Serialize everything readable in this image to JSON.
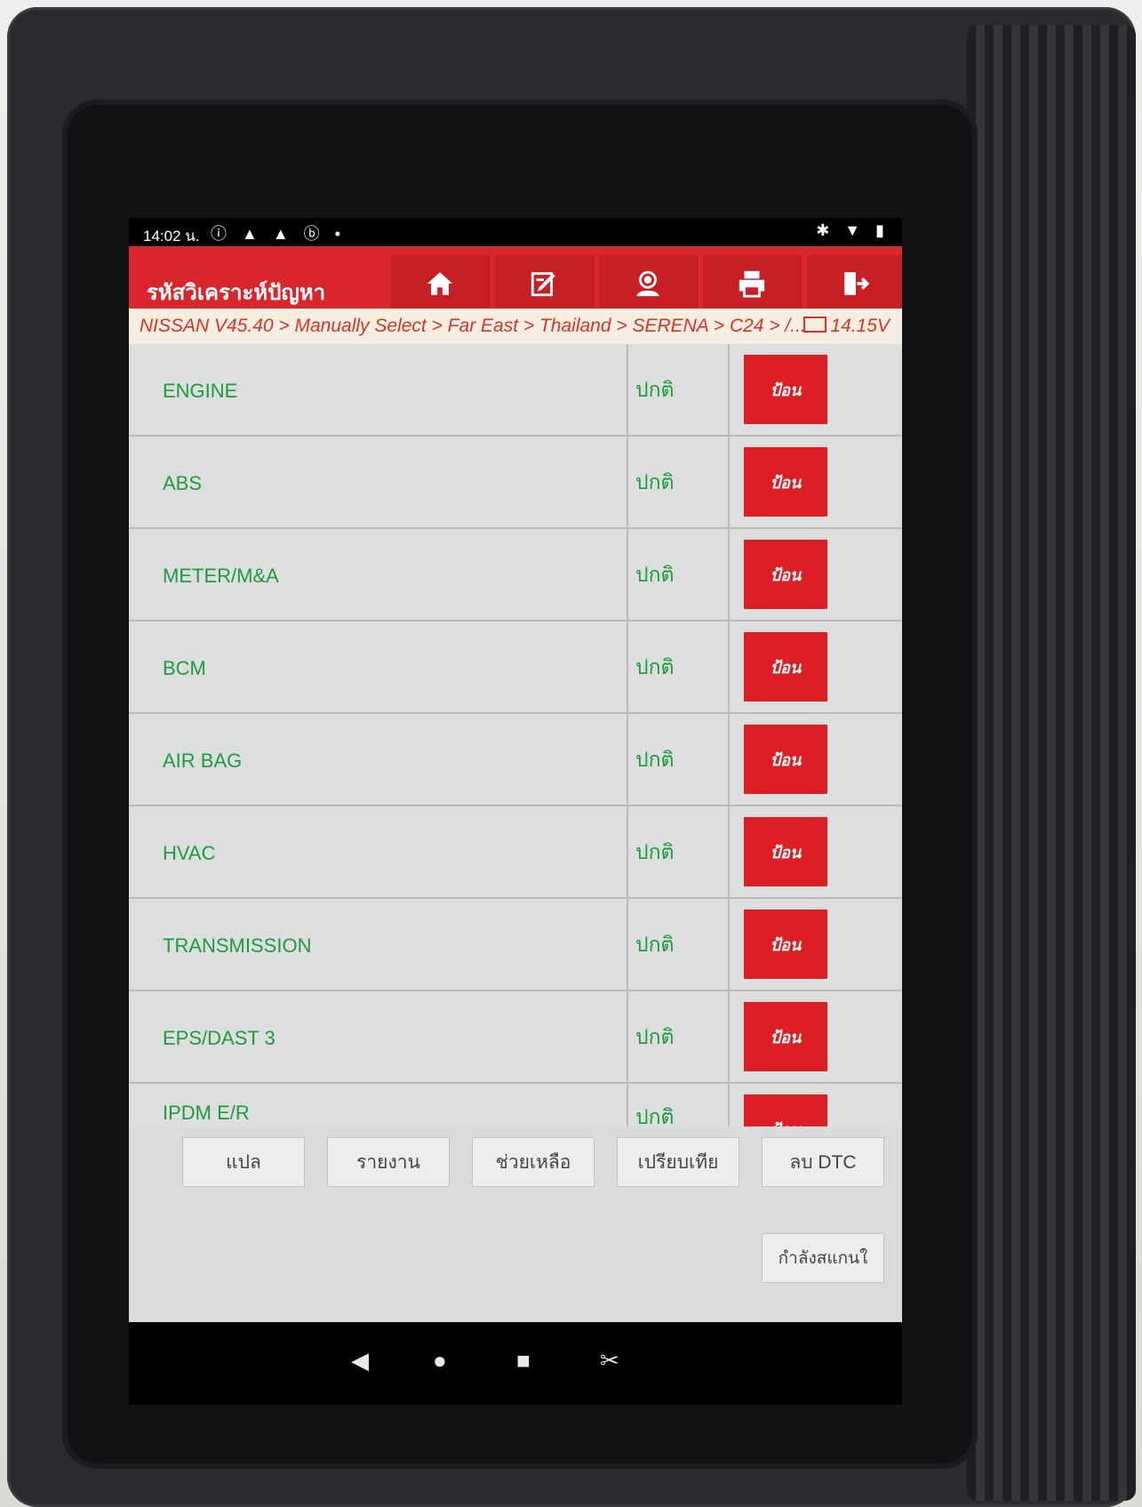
{
  "status_bar": {
    "time": "14:02 น.",
    "left_icons": "ⓘ ▲ ▲ ⓑ •",
    "right_icons": "✱ ▼ ▮"
  },
  "header": {
    "title": "รหัสวิเคราะห์ปัญหา",
    "toolbar": [
      {
        "icon": "home-icon"
      },
      {
        "icon": "edit-icon"
      },
      {
        "icon": "support-icon"
      },
      {
        "icon": "print-icon"
      },
      {
        "icon": "exit-icon"
      }
    ]
  },
  "breadcrumb": {
    "path": "NISSAN V45.40 > Manually Select > Far East > Thailand > SERENA > C24 > /...",
    "voltage": "14.15V"
  },
  "systems": [
    {
      "name": "ENGINE",
      "status": "ปกติ",
      "button": "ป้อน"
    },
    {
      "name": "ABS",
      "status": "ปกติ",
      "button": "ป้อน"
    },
    {
      "name": "METER/M&A",
      "status": "ปกติ",
      "button": "ป้อน"
    },
    {
      "name": "BCM",
      "status": "ปกติ",
      "button": "ป้อน"
    },
    {
      "name": "AIR BAG",
      "status": "ปกติ",
      "button": "ป้อน"
    },
    {
      "name": "HVAC",
      "status": "ปกติ",
      "button": "ป้อน"
    },
    {
      "name": "TRANSMISSION",
      "status": "ปกติ",
      "button": "ป้อน"
    },
    {
      "name": "EPS/DAST 3",
      "status": "ปกติ",
      "button": "ป้อน"
    },
    {
      "name": "IPDM E/R",
      "status": "ปกติ",
      "button": "ป้อน"
    }
  ],
  "bottom_buttons": {
    "translate": "แปล",
    "report": "รายงาน",
    "help": "ช่วยเหลือ",
    "compare": "เปรียบเทีย",
    "clear_dtc": "ลบ DTC",
    "scanning": "กำลังสแกนใ"
  },
  "navbar": {
    "back": "◀",
    "home": "●",
    "recents": "■",
    "screenshot": "✂"
  }
}
